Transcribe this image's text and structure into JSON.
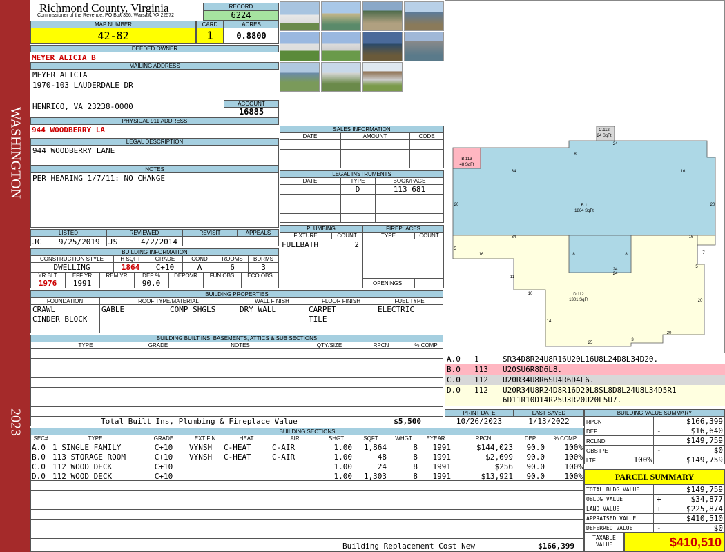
{
  "side": {
    "county_vertical": "WASHINGTON",
    "year": "2023"
  },
  "header": {
    "county": "Richmond County, Virginia",
    "address": "Commissioner of the Revenue, PO Box 366, Warsaw, VA 22572"
  },
  "record": {
    "label": "RECORD",
    "value": "6224"
  },
  "map": {
    "label": "MAP NUMBER",
    "value": "42-82"
  },
  "card": {
    "label": "CARD",
    "value": "1"
  },
  "acres": {
    "label": "ACRES",
    "value": "0.8800"
  },
  "owner": {
    "label": "DEEDED OWNER",
    "value": "MEYER ALICIA B"
  },
  "mailing": {
    "label": "MAILING ADDRESS",
    "line1": "MEYER ALICIA",
    "line2": "1970-103 LAUDERDALE DR",
    "line3": "HENRICO, VA 23238-0000"
  },
  "account": {
    "label": "ACCOUNT",
    "value": "16885"
  },
  "physical": {
    "label": "PHYSICAL 911 ADDRESS",
    "value": "944 WOODBERRY LA"
  },
  "legal": {
    "label": "LEGAL DESCRIPTION",
    "value": "944 WOODBERRY LANE"
  },
  "notes": {
    "label": "NOTES",
    "value": "PER HEARING 1/7/11: NO CHANGE"
  },
  "sales": {
    "label": "SALES INFORMATION",
    "h_date": "DATE",
    "h_amount": "AMOUNT",
    "h_code": "CODE"
  },
  "instruments": {
    "label": "LEGAL INSTRUMENTS",
    "h_date": "DATE",
    "h_type": "TYPE",
    "h_book": "BOOK/PAGE",
    "type": "D",
    "book": "113 681"
  },
  "status": {
    "h_listed": "LISTED",
    "h_reviewed": "REVIEWED",
    "h_revisit": "REVISIT",
    "h_appeals": "APPEALS",
    "listed_by": "JC",
    "listed_date": "9/25/2019",
    "reviewed_by": "JS",
    "reviewed_date": "4/2/2014"
  },
  "bldg": {
    "label": "BUILDING INFORMATION",
    "h_style": "CONSTRUCTION STYLE",
    "h_hsqft": "H SQFT",
    "h_grade": "GRADE",
    "h_cond": "COND",
    "h_rooms": "ROOMS",
    "h_bdrms": "BDRMS",
    "style": "DWELLING",
    "hsqft": "1864",
    "grade": "C+10",
    "cond": "A",
    "rooms": "6",
    "bdrms": "3",
    "h_yrblt": "YR BLT",
    "h_effyr": "EFF YR",
    "h_remyr": "REM YR",
    "h_dep": "DEP %",
    "h_depovr": "DEPOVR",
    "h_funobs": "FUN OBS",
    "h_ecoobs": "ECO OBS",
    "yrblt": "1976",
    "effyr": "1991",
    "dep": "90.0"
  },
  "plumbing": {
    "label": "PLUMBING",
    "h_fixture": "FIXTURE",
    "h_count": "COUNT",
    "fixture": "FULLBATH",
    "count": "2"
  },
  "fireplaces": {
    "label": "FIREPLACES",
    "h_type": "TYPE",
    "h_count": "COUNT",
    "openings": "OPENINGS"
  },
  "props": {
    "label": "BUILDING PROPERTIES",
    "h_foundation": "FOUNDATION",
    "h_roof": "ROOF TYPE/MATERIAL",
    "h_wall": "WALL FINISH",
    "h_floor": "FLOOR FINISH",
    "h_fuel": "FUEL TYPE",
    "found1": "CRAWL",
    "found2": "CINDER BLOCK",
    "roof1": "GABLE",
    "roof2": "COMP SHGLS",
    "wall": "DRY WALL",
    "floor1": "CARPET",
    "floor2": "TILE",
    "fuel": "ELECTRIC"
  },
  "builtins": {
    "label": "BUILDING BUILT INS, BASEMENTS, ATTICS & SUB SECTIONS",
    "h_type": "TYPE",
    "h_grade": "GRADE",
    "h_notes": "NOTES",
    "h_qty": "QTY/SIZE",
    "h_rpcn": "RPCN",
    "h_comp": "% COMP",
    "total_label": "Total Built Ins, Plumbing & Fireplace Value",
    "total_value": "$5,500"
  },
  "dates": {
    "h_print": "PRINT DATE",
    "h_saved": "LAST SAVED",
    "print": "10/26/2023",
    "saved": "1/13/2022"
  },
  "sketch": {
    "areas": [
      {
        "name": "A.0",
        "code": "1",
        "desc": "SR34D8R24U8R16U20L16U8L24D8L34D20."
      },
      {
        "name": "B.0",
        "code": "113",
        "desc": "U20SU6R8D6L8."
      },
      {
        "name": "C.0",
        "code": "112",
        "desc": "U20R34U8R6SU4R6D4L6."
      },
      {
        "name": "D.0",
        "code": "112",
        "desc": "U20R34U8R24D8R16D20L8SL8D8L24U8L34D5R1",
        "desc2": "6D11R10D14R25U3R20U20L5U7."
      }
    ],
    "labels": {
      "c_title": "C.112",
      "c_area": "24 SqFt",
      "b_title": "B.113",
      "b_area": "48 SqFt",
      "a_title": "B.1",
      "a_area": "1864 SqFt",
      "d_title": "D.112",
      "d_area": "1301 SqFt"
    },
    "dims": [
      "24",
      "8",
      "16",
      "34",
      "20",
      "20",
      "16",
      "34",
      "8",
      "8",
      "24",
      "24",
      "5",
      "16",
      "7",
      "5",
      "11",
      "10",
      "20",
      "14",
      "20",
      "25",
      "3"
    ]
  },
  "sections": {
    "label": "BUILDING SECTIONS",
    "headers": [
      "SEC#",
      "TYPE",
      "GRADE",
      "EXT FIN",
      "HEAT",
      "AIR",
      "SHGT",
      "SQFT",
      "WHGT",
      "EYEAR",
      "RPCN",
      "DEP",
      "% COMP"
    ],
    "rows": [
      [
        "A.0",
        "1 SINGLE FAMILY",
        "C+10",
        "VYNSH",
        "C-HEAT",
        "C-AIR",
        "1.00",
        "1,864",
        "8",
        "1991",
        "$144,023",
        "90.0",
        "100%"
      ],
      [
        "B.0",
        "113 STORAGE ROOM",
        "C+10",
        "VYNSH",
        "C-HEAT",
        "C-AIR",
        "1.00",
        "48",
        "8",
        "1991",
        "$2,699",
        "90.0",
        "100%"
      ],
      [
        "C.0",
        "112 WOOD DECK",
        "C+10",
        "",
        "",
        "",
        "1.00",
        "24",
        "8",
        "1991",
        "$256",
        "90.0",
        "100%"
      ],
      [
        "D.0",
        "112 WOOD DECK",
        "C+10",
        "",
        "",
        "",
        "1.00",
        "1,303",
        "8",
        "1991",
        "$13,921",
        "90.0",
        "100%"
      ]
    ],
    "replacement_label": "Building Replacement Cost New",
    "replacement_value": "$166,399"
  },
  "bvs": {
    "label": "BUILDING VALUE SUMMARY",
    "rpcn_l": "RPCN",
    "rpcn": "$166,399",
    "dep_l": "DEP",
    "dep_sign": "-",
    "dep": "$16,640",
    "rclnd_l": "RCLND",
    "rclnd": "$149,759",
    "obs_l": "OBS F/E",
    "obs_sign": "-",
    "obs": "$0",
    "ltf_l": "LTF",
    "ltf_pct": "100%",
    "ltf": "$149,759"
  },
  "parcel": {
    "label": "PARCEL SUMMARY",
    "tbv_l": "TOTAL BLDG VALUE",
    "tbv": "$149,759",
    "obldg_l": "OBLDG VALUE",
    "obldg_sign": "+",
    "obldg": "$34,877",
    "land_l": "LAND VALUE",
    "land_sign": "+",
    "land": "$225,874",
    "appr_l": "APPRAISED VALUE",
    "appr": "$410,510",
    "def_l": "DEFERRED VALUE",
    "def_sign": "-",
    "def": "$0",
    "tax_l1": "TAXABLE",
    "tax_l2": "VALUE",
    "tax": "$410,510"
  },
  "colors": {
    "band": "#a52a2a",
    "header_blue": "#a5cfe0",
    "yellow": "#ffff00",
    "green": "#a6e3a0",
    "sketch_blue": "#add8e6",
    "sketch_yellow": "#ffffe0",
    "sketch_pink": "#ffb6c1"
  }
}
